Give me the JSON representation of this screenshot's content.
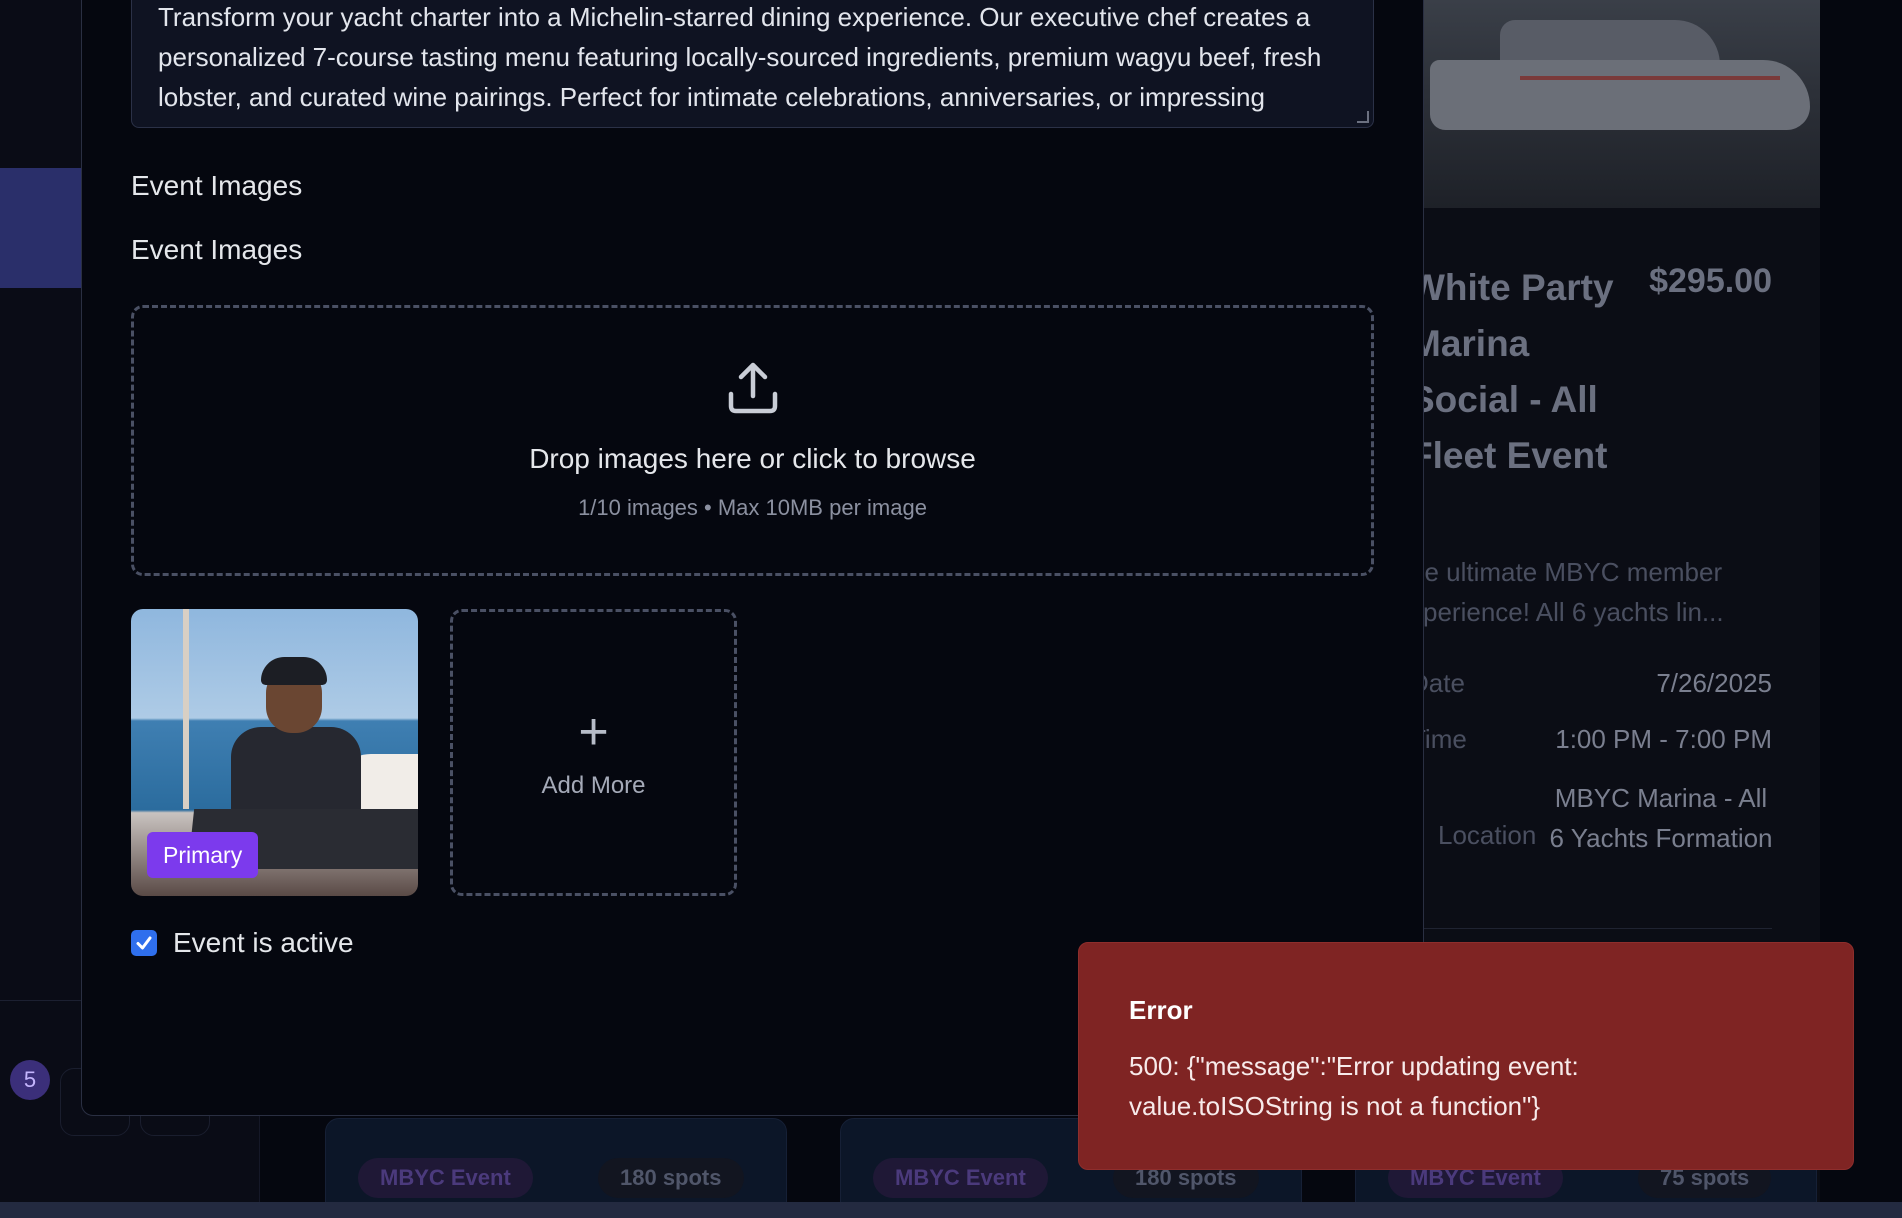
{
  "modal": {
    "description_text": "Transform your yacht charter into a Michelin-starred dining experience. Our executive chef creates a personalized 7-course tasting menu featuring locally-sourced ingredients, premium wagyu beef, fresh lobster, and curated wine pairings. Perfect for intimate celebrations, anniversaries, or impressing business clients during your charter.",
    "images_section_label": "Event Images",
    "images_field_label": "Event Images",
    "dropzone": {
      "main_text": "Drop images here or click to browse",
      "sub_text": "1/10 images • Max 10MB per image",
      "icon": "upload-icon"
    },
    "thumbnails": [
      {
        "badge": "Primary"
      }
    ],
    "add_more_label": "Add More",
    "add_more_icon": "plus-icon",
    "active_checkbox": {
      "label": "Event is active",
      "checked": true
    }
  },
  "toast": {
    "title": "Error",
    "message": "500: {\"message\":\"Error updating event: value.toISOString is not a function\"}",
    "color": "#7f2423"
  },
  "background": {
    "event_card": {
      "title": "White Party Marina Social - All Fleet Event",
      "price": "$295.00",
      "description": "he ultimate MBYC member xperience! All 6 yachts lin...",
      "date_label": "Date",
      "date_value": "7/26/2025",
      "time_label": "Time",
      "time_value": "1:00 PM - 7:00 PM",
      "location_label": "Location",
      "location_value": "MBYC Marina - All 6 Yachts Formation"
    },
    "notification_count": "5",
    "tiles": [
      {
        "tag": "MBYC Event",
        "spots": "180 spots"
      },
      {
        "tag": "MBYC Event",
        "spots": "180 spots"
      },
      {
        "tag": "MBYC Event",
        "spots": "75 spots"
      }
    ]
  }
}
